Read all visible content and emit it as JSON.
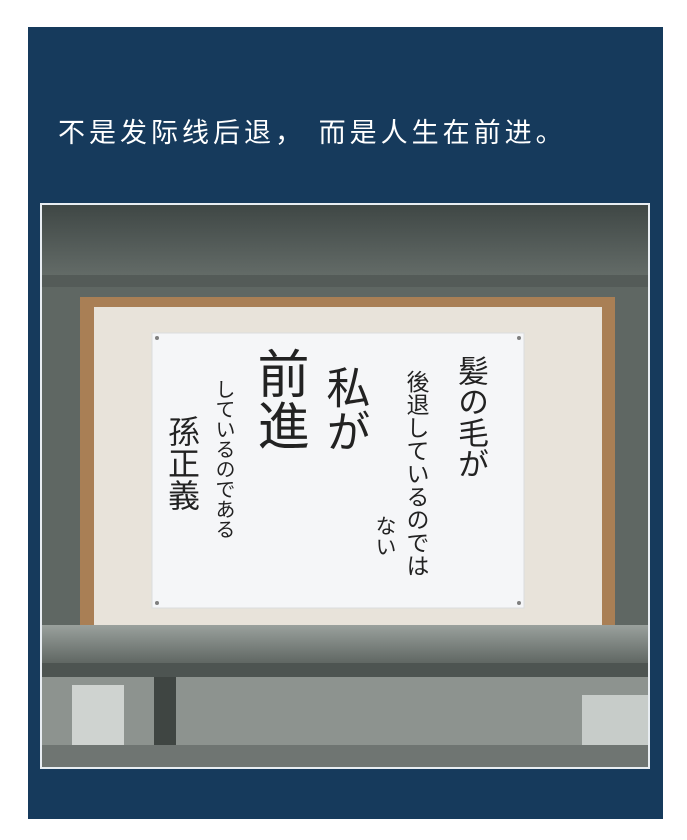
{
  "caption": "不是发际线后退， 而是人生在前进。",
  "notice": {
    "col1": "髪の毛が",
    "col2": "後退しているのでは",
    "col3": "ない",
    "col4": "私が",
    "col5": "前進",
    "col6": "しているのである",
    "col7": "孫正義"
  },
  "colors": {
    "card_background": "#163a5c",
    "caption_text": "#ffffff",
    "paper": "#f5f6f8",
    "board_frame": "#5f6763"
  }
}
